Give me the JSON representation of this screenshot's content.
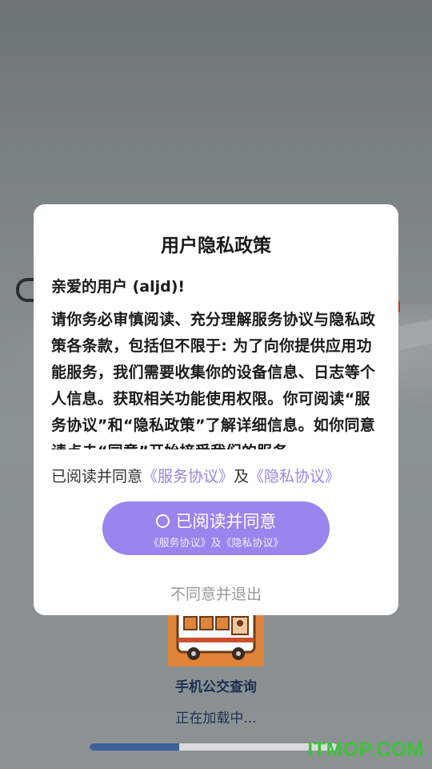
{
  "dialog": {
    "title": "用户隐私政策",
    "greeting": "亲爱的用户 (aljd)!",
    "body": "请你务必审慎阅读、充分理解服务协议与隐私政策各条款，包括但不限于: 为了向你提供应用功能服务，我们需要收集你的设备信息、日志等个人信息。获取相关功能使用权限。你可阅读“服务协议”和“隐私政策”了解详细信息。如你同意请点击“同意”开始接受我们的服务。",
    "agree_prefix": "已阅读并同意",
    "service_link": "《服务协议》",
    "and": "及",
    "privacy_link": "《隐私协议》",
    "agree_button_label": "已阅读并同意",
    "agree_button_sub": "《服务协议》及《隐私协议》",
    "decline_label": "不同意并退出"
  },
  "splash": {
    "app_name": "手机公交查询",
    "loading_text": "正在加载中...",
    "progress_fraction": 0.36
  },
  "watermark": "ITMOP.COM",
  "colors": {
    "accent": "#9a84ee",
    "link": "#9b86e0",
    "progress": "#3f5f98",
    "watermark": "#3fc23a"
  }
}
